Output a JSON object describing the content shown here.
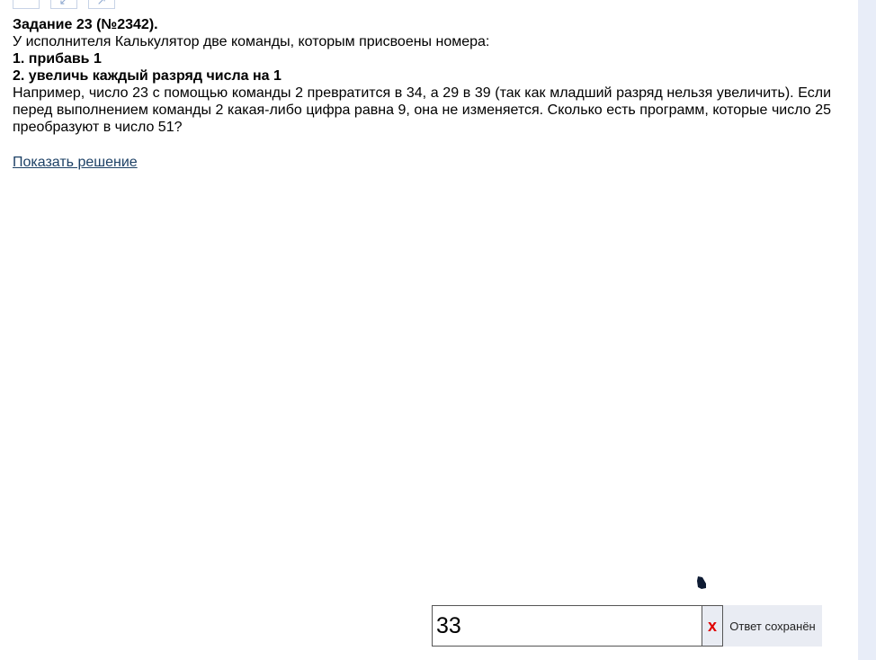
{
  "toolbar": {
    "icons": [
      "blank-icon",
      "collapse-arrow-icon",
      "expand-arrow-icon"
    ]
  },
  "task": {
    "title": "Задание 23 (№2342).",
    "intro": "У исполнителя Калькулятор две команды, которым присвоены номера:",
    "command1": "1. прибавь 1",
    "command2": "2. увеличь каждый разряд числа на 1",
    "body": "Например, число 23 с помощью команды 2 превратится в 34, а 29 в 39 (так как младший разряд нельзя увеличить). Если перед выполнением команды 2 какая-либо цифра равна 9, она не изменяется. Сколько есть программ, которые число 25 преобразуют в число 51?"
  },
  "solution_link": "Показать решение",
  "answer": {
    "value": "33",
    "clear_label": "x",
    "status": "Ответ сохранён"
  }
}
